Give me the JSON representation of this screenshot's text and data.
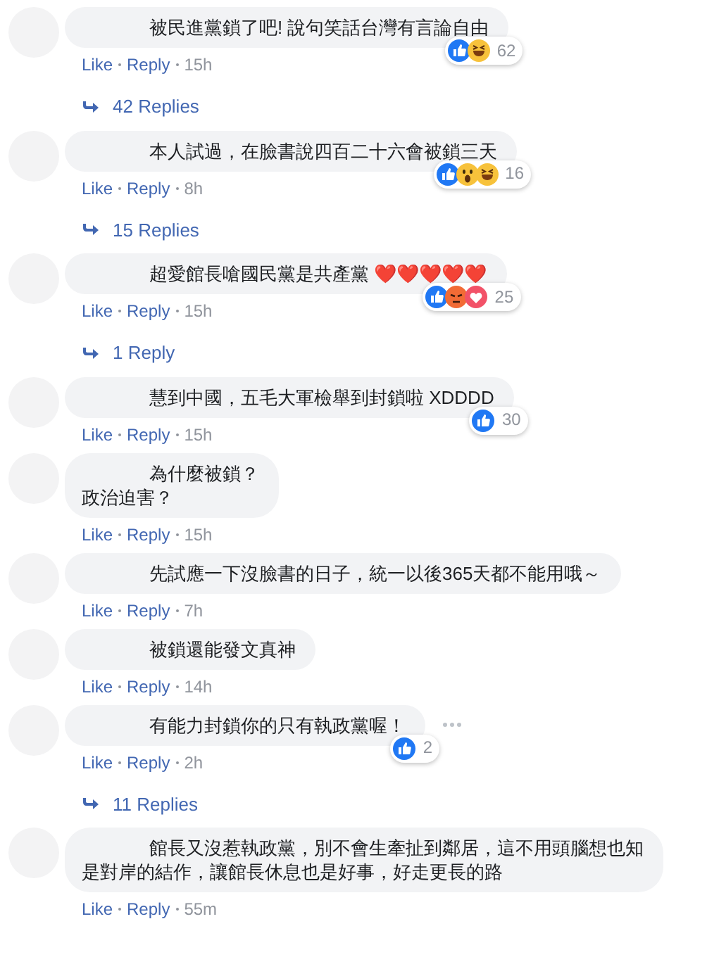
{
  "comments": [
    {
      "lines": [
        "被民進黨鎖了吧! 說句笑話台灣有言論自由"
      ],
      "reactions": [
        {
          "kind": "like"
        },
        {
          "kind": "haha"
        }
      ],
      "reaction_count": "62",
      "actions": [
        "Like",
        "Reply"
      ],
      "time": "15h",
      "replies": "42 Replies",
      "options": false
    },
    {
      "lines": [
        "本人試過，在臉書說四百二十六會被鎖三天"
      ],
      "reactions": [
        {
          "kind": "like"
        },
        {
          "kind": "wow"
        },
        {
          "kind": "haha"
        }
      ],
      "reaction_count": "16",
      "actions": [
        "Like",
        "Reply"
      ],
      "time": "8h",
      "replies": "15 Replies",
      "options": false
    },
    {
      "lines": [
        "超愛館長嗆國民黨是共產黨 ❤️❤️❤️❤️❤️"
      ],
      "reactions": [
        {
          "kind": "like"
        },
        {
          "kind": "angry"
        },
        {
          "kind": "love"
        }
      ],
      "reaction_count": "25",
      "actions": [
        "Like",
        "Reply"
      ],
      "time": "15h",
      "replies": "1 Reply",
      "options": false
    },
    {
      "lines": [
        "慧到中國，五毛大軍檢舉到封鎖啦 XDDDD"
      ],
      "reactions": [
        {
          "kind": "like"
        }
      ],
      "reaction_count": "30",
      "actions": [
        "Like",
        "Reply"
      ],
      "time": "15h",
      "options": false
    },
    {
      "lines": [
        "為什麼被鎖？",
        "政治迫害？"
      ],
      "actions": [
        "Like",
        "Reply"
      ],
      "time": "15h",
      "options": false
    },
    {
      "lines": [
        "先試應一下沒臉書的日子，統一以後365天都不能用哦～"
      ],
      "actions": [
        "Like",
        "Reply"
      ],
      "time": "7h",
      "options": false
    },
    {
      "lines": [
        "被鎖還能發文真神"
      ],
      "actions": [
        "Like",
        "Reply"
      ],
      "time": "14h",
      "options": false
    },
    {
      "lines": [
        "有能力封鎖你的只有執政黨喔！"
      ],
      "reactions": [
        {
          "kind": "like"
        }
      ],
      "reaction_count": "2",
      "actions": [
        "Like",
        "Reply"
      ],
      "time": "2h",
      "replies": "11 Replies",
      "options": true
    },
    {
      "lines": [
        "館長又沒惹執政黨，別不會生牽扯到鄰居，這不用頭腦想也知",
        "是對岸的結作，讓館長休息也是好事，好走更長的路"
      ],
      "actions": [
        "Like",
        "Reply"
      ],
      "time": "55m",
      "options": false
    }
  ]
}
